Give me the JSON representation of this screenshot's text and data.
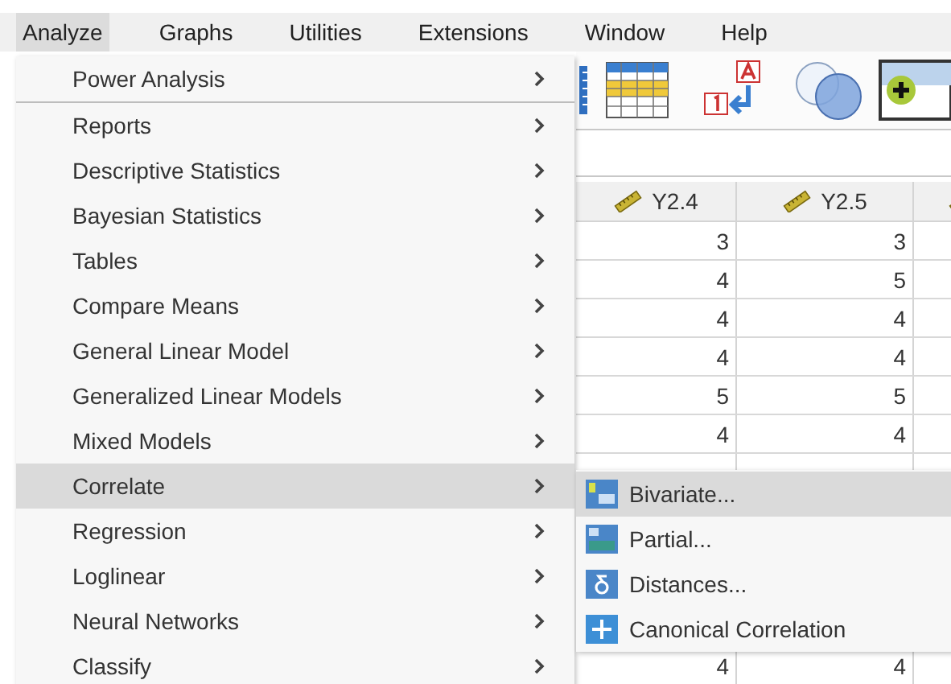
{
  "menubar": [
    {
      "label": "Analyze",
      "selected": true
    },
    {
      "label": "Graphs",
      "selected": false
    },
    {
      "label": "Utilities",
      "selected": false
    },
    {
      "label": "Extensions",
      "selected": false
    },
    {
      "label": "Window",
      "selected": false
    },
    {
      "label": "Help",
      "selected": false
    }
  ],
  "grid": {
    "columns": [
      "Y2.4",
      "Y2.5",
      ""
    ],
    "rows": [
      [
        "3",
        "3"
      ],
      [
        "4",
        "5"
      ],
      [
        "4",
        "4"
      ],
      [
        "4",
        "4"
      ],
      [
        "5",
        "5"
      ],
      [
        "4",
        "4"
      ]
    ],
    "rows_below": [
      [
        "4",
        "4"
      ]
    ]
  },
  "menu": {
    "items": [
      {
        "kind": "item",
        "label": "Power Analysis",
        "selected": false,
        "submenu": true
      },
      {
        "kind": "separator"
      },
      {
        "kind": "item",
        "label": "Reports",
        "selected": false,
        "submenu": true
      },
      {
        "kind": "item",
        "label": "Descriptive Statistics",
        "selected": false,
        "submenu": true
      },
      {
        "kind": "item",
        "label": "Bayesian Statistics",
        "selected": false,
        "submenu": true
      },
      {
        "kind": "item",
        "label": "Tables",
        "selected": false,
        "submenu": true
      },
      {
        "kind": "item",
        "label": "Compare Means",
        "selected": false,
        "submenu": true
      },
      {
        "kind": "item",
        "label": "General Linear Model",
        "selected": false,
        "submenu": true
      },
      {
        "kind": "item",
        "label": "Generalized Linear Models",
        "selected": false,
        "submenu": true
      },
      {
        "kind": "item",
        "label": "Mixed Models",
        "selected": false,
        "submenu": true
      },
      {
        "kind": "item",
        "label": "Correlate",
        "selected": true,
        "submenu": true
      },
      {
        "kind": "item",
        "label": "Regression",
        "selected": false,
        "submenu": true
      },
      {
        "kind": "item",
        "label": "Loglinear",
        "selected": false,
        "submenu": true
      },
      {
        "kind": "item",
        "label": "Neural Networks",
        "selected": false,
        "submenu": true
      },
      {
        "kind": "item",
        "label": "Classify",
        "selected": false,
        "submenu": true
      }
    ]
  },
  "submenu": {
    "items": [
      {
        "kind": "bivariate",
        "label": "Bivariate...",
        "selected": true
      },
      {
        "kind": "partial",
        "label": "Partial...",
        "selected": false
      },
      {
        "kind": "distances",
        "label": "Distances...",
        "selected": false
      },
      {
        "kind": "canonical",
        "label": "Canonical Correlation",
        "selected": false
      }
    ]
  }
}
